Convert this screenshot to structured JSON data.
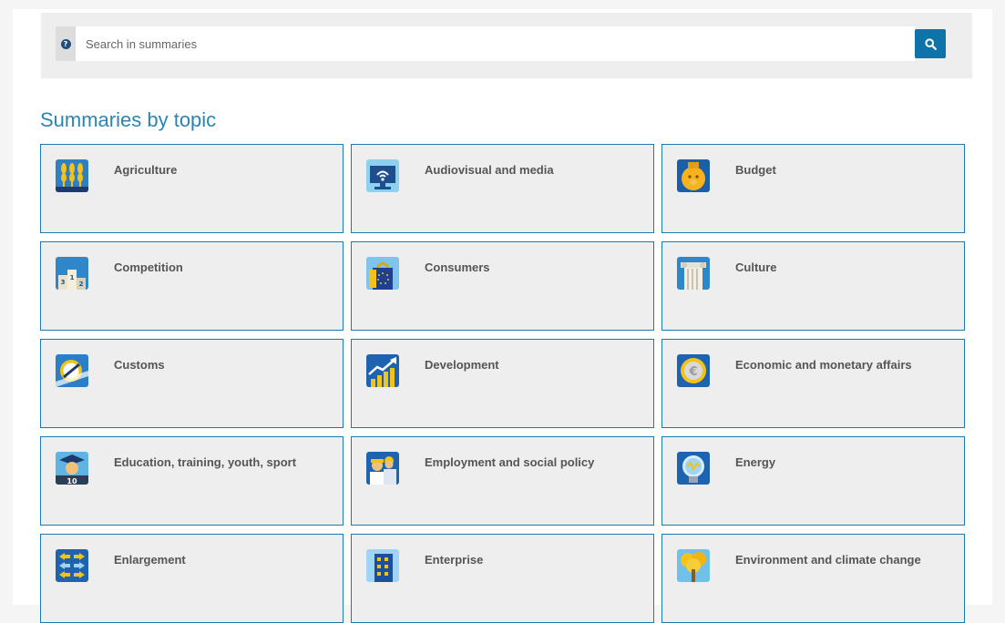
{
  "search": {
    "placeholder": "Search in summaries",
    "help_icon": "question-circle-icon",
    "button_icon": "search-icon"
  },
  "section_title": "Summaries by topic",
  "colors": {
    "accent": "#1b7aaf",
    "title": "#2a85b5",
    "button": "#0e73a8",
    "tile_bg": "#eeeeee"
  },
  "topics": [
    {
      "label": "Agriculture",
      "icon": "wheat-icon"
    },
    {
      "label": "Audiovisual and media",
      "icon": "monitor-wifi-icon"
    },
    {
      "label": "Budget",
      "icon": "piggy-bank-icon"
    },
    {
      "label": "Competition",
      "icon": "podium-icon"
    },
    {
      "label": "Consumers",
      "icon": "shopping-bag-icon"
    },
    {
      "label": "Culture",
      "icon": "column-icon"
    },
    {
      "label": "Customs",
      "icon": "no-entry-icon"
    },
    {
      "label": "Development",
      "icon": "growth-chart-icon"
    },
    {
      "label": "Economic and monetary affairs",
      "icon": "euro-coin-icon"
    },
    {
      "label": "Education, training, youth, sport",
      "icon": "graduate-icon"
    },
    {
      "label": "Employment and social policy",
      "icon": "workers-icon"
    },
    {
      "label": "Energy",
      "icon": "light-bulb-icon"
    },
    {
      "label": "Enlargement",
      "icon": "arrows-icon"
    },
    {
      "label": "Enterprise",
      "icon": "building-icon"
    },
    {
      "label": "Environment and climate change",
      "icon": "tree-icon"
    }
  ]
}
